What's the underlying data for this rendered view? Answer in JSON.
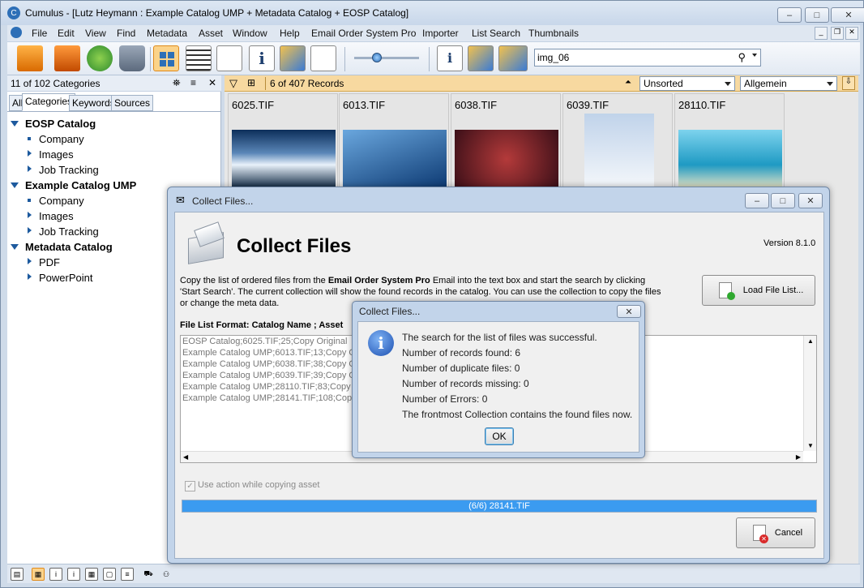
{
  "window": {
    "title": "Cumulus - [Lutz Heymann : Example Catalog UMP + Metadata Catalog + EOSP Catalog]",
    "minimize": "–",
    "maximize": "□",
    "close": "✕"
  },
  "menu": [
    "File",
    "Edit",
    "View",
    "Find",
    "Metadata",
    "Asset",
    "Window",
    "Help",
    "Email Order System Pro",
    "Importer",
    "List Search",
    "Thumbnails"
  ],
  "search": {
    "value": "img_06"
  },
  "left_panel": {
    "count": "11 of 102 Categories",
    "tabs": [
      "All",
      "Categories",
      "Keywords",
      "Sources"
    ],
    "tree": [
      {
        "label": "EOSP Catalog",
        "level": 0
      },
      {
        "label": "Company",
        "level": 1,
        "bullet": "square"
      },
      {
        "label": "Images",
        "level": 1,
        "bullet": "arrow"
      },
      {
        "label": "Job Tracking",
        "level": 1,
        "bullet": "arrow"
      },
      {
        "label": "Example Catalog UMP",
        "level": 0
      },
      {
        "label": "Company",
        "level": 1,
        "bullet": "square"
      },
      {
        "label": "Images",
        "level": 1,
        "bullet": "arrow"
      },
      {
        "label": "Job Tracking",
        "level": 1,
        "bullet": "arrow"
      },
      {
        "label": "Metadata Catalog",
        "level": 0
      },
      {
        "label": "PDF",
        "level": 1,
        "bullet": "arrow"
      },
      {
        "label": "PowerPoint",
        "level": 1,
        "bullet": "arrow"
      }
    ]
  },
  "records": {
    "count": "6 of 407 Records",
    "sort": "Unsorted",
    "view": "Allgemein"
  },
  "thumbnails": [
    {
      "name": "6025.TIF",
      "colors": [
        "#8fb6dd",
        "#0d2b52"
      ]
    },
    {
      "name": "6013.TIF",
      "colors": [
        "#3f7fbf",
        "#0d3a73"
      ]
    },
    {
      "name": "6038.TIF",
      "colors": [
        "#6a2a2a",
        "#2b0b12"
      ]
    },
    {
      "name": "6039.TIF",
      "colors": [
        "#e8eef6",
        "#c0d3ea"
      ]
    },
    {
      "name": "28110.TIF",
      "colors": [
        "#6ec6e6",
        "#2a9dc7"
      ]
    }
  ],
  "dialog": {
    "title": "Collect Files...",
    "heading": "Collect Files",
    "version": "Version 8.1.0",
    "desc_line1_pre": "Copy the list of ordered files from the ",
    "desc_line1_bold": "Email Order System Pro",
    "desc_line1_post": " Email into the text box and start the search by clicking",
    "desc_line2": "'Start Search'. The current collection will show the found records in the catalog. You can use the collection to copy the files",
    "desc_line3": "or change the meta data.",
    "load_button": "Load File List...",
    "format_label": "File List Format: Catalog Name ; Asset",
    "lines": [
      "EOSP Catalog;6025.TIF;25;Copy Original",
      "Example Catalog UMP;6013.TIF;13;Copy Or",
      "Example Catalog UMP;6038.TIF;38;Copy Or",
      "Example Catalog UMP;6039.TIF;39;Copy Or",
      "Example Catalog UMP;28110.TIF;83;Copy C",
      "Example Catalog UMP;28141.TIF;108;Copy"
    ],
    "checkbox_label": "Use action while copying asset",
    "progress_text": "(6/6) 28141.TIF",
    "progress": 1.0,
    "cancel_button": "Cancel"
  },
  "message": {
    "title": "Collect Files...",
    "lines": [
      "The search for the list of files was successful.",
      "Number of records found: 6",
      "Number of duplicate files: 0",
      "Number of records missing: 0",
      "Number of Errors: 0",
      "The frontmost Collection contains the found files now."
    ],
    "ok": "OK"
  }
}
